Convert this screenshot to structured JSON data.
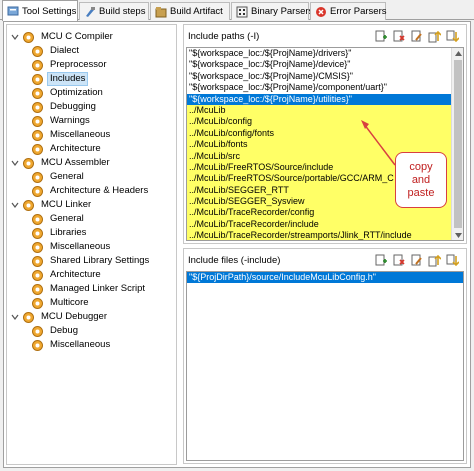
{
  "tabs": [
    {
      "label": "Tool Settings",
      "icon": "tool-settings-icon",
      "active": true
    },
    {
      "label": "Build steps",
      "icon": "build-steps-icon"
    },
    {
      "label": "Build Artifact",
      "icon": "build-artifact-icon"
    },
    {
      "label": "Binary Parsers",
      "icon": "binary-parsers-icon"
    },
    {
      "label": "Error Parsers",
      "icon": "error-parsers-icon"
    }
  ],
  "tree": {
    "mcu_c_compiler": "MCU C Compiler",
    "dialect": "Dialect",
    "preprocessor": "Preprocessor",
    "includes": "Includes",
    "optimization": "Optimization",
    "debugging": "Debugging",
    "warnings": "Warnings",
    "miscellaneous1": "Miscellaneous",
    "architecture1": "Architecture",
    "mcu_assembler": "MCU Assembler",
    "general1": "General",
    "arch_headers": "Architecture & Headers",
    "mcu_linker": "MCU Linker",
    "general2": "General",
    "libraries": "Libraries",
    "miscellaneous2": "Miscellaneous",
    "shared_lib": "Shared Library Settings",
    "architecture2": "Architecture",
    "managed_linker": "Managed Linker Script",
    "multicore": "Multicore",
    "mcu_debugger": "MCU Debugger",
    "debug": "Debug",
    "miscellaneous3": "Miscellaneous"
  },
  "include_paths": {
    "title": "Include paths (-I)",
    "rows": [
      "\"${workspace_loc:/${ProjName}/drivers}\"",
      "\"${workspace_loc:/${ProjName}/device}\"",
      "\"${workspace_loc:/${ProjName}/CMSIS}\"",
      "\"${workspace_loc:/${ProjName}/component/uart}\"",
      "\"${workspace_loc:/${ProjName}/utilities}\"",
      "../McuLib",
      "../McuLib/config",
      "../McuLib/config/fonts",
      "../McuLib/fonts",
      "../McuLib/src",
      "../McuLib/FreeRTOS/Source/include",
      "../McuLib/FreeRTOS/Source/portable/GCC/ARM_C",
      "../McuLib/SEGGER_RTT",
      "../McuLib/SEGGER_Sysview",
      "../McuLib/TraceRecorder/config",
      "../McuLib/TraceRecorder/include",
      "../McuLib/TraceRecorder/streamports/Jlink_RTT/include"
    ]
  },
  "include_files": {
    "title": "Include files (-include)",
    "rows": [
      "\"${ProjDirPath}/source/IncludeMcuLibConfig.h\""
    ]
  },
  "callout": {
    "line1": "copy",
    "line2": "and",
    "line3": "paste"
  },
  "colors": {
    "highlight": "#ffff66",
    "selection": "#0078d7",
    "callout_border": "#d84040"
  }
}
